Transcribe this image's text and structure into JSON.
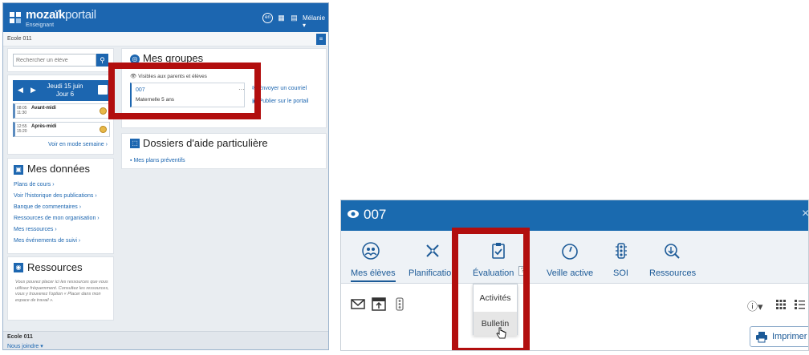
{
  "left": {
    "brand_bold": "mozaïk",
    "brand_light": "portail",
    "role": "Enseignant",
    "user": "Mélanie ▾",
    "school": "Ecole 011",
    "search_placeholder": "Rechercher un élève",
    "calendar": {
      "date_line1": "Jeudi 15 juin",
      "date_line2": "Jour 6",
      "slots": [
        {
          "start": "08:05",
          "end": "11:30",
          "label": "Avant-midi"
        },
        {
          "start": "12:55",
          "end": "15:20",
          "label": "Après-midi"
        }
      ],
      "week_link": "Voir en mode semaine"
    },
    "mydata": {
      "title": "Mes données",
      "links": [
        "Plans de cours",
        "Voir l'historique des publications",
        "Banque de commentaires",
        "Ressources de mon organisation",
        "Mes ressources",
        "Mes événements de suivi"
      ]
    },
    "resources": {
      "title": "Ressources",
      "note": "Vous pouvez placer ici les ressources que vous utilisez fréquemment. Consultez les ressources, vous y trouverez l'option « Placer dans mon espace de travail »."
    },
    "groups": {
      "title": "Mes groupes",
      "visibility": "Visibles aux parents et élèves",
      "card_code": "007",
      "card_level": "Maternelle 5 ans",
      "more": "···",
      "action_email": "Envoyer un courriel",
      "action_publish": "Publier sur le portail"
    },
    "dossiers": {
      "title": "Dossiers d'aide particulière",
      "link": "Mes plans préventifs"
    },
    "footer": {
      "school": "Ecole 011",
      "join": "Nous joindre ▾"
    }
  },
  "right": {
    "title": "007",
    "close": "×",
    "tabs": [
      {
        "label": "Mes élèves",
        "icon": "students-icon"
      },
      {
        "label": "Planification",
        "icon": "tools-icon"
      },
      {
        "label": "Évaluation",
        "icon": "clipboard-check-icon"
      },
      {
        "label": "Veille active",
        "icon": "gauge-icon"
      },
      {
        "label": "SOI",
        "icon": "traffic-light-icon"
      },
      {
        "label": "Ressources",
        "icon": "resources-icon"
      }
    ],
    "dropdown": [
      "Activités",
      "Bulletin"
    ],
    "info": "ⓘ▾",
    "print": "Imprimer"
  },
  "colors": {
    "brand": "#1c66b0",
    "highlight": "#b20e0e"
  }
}
